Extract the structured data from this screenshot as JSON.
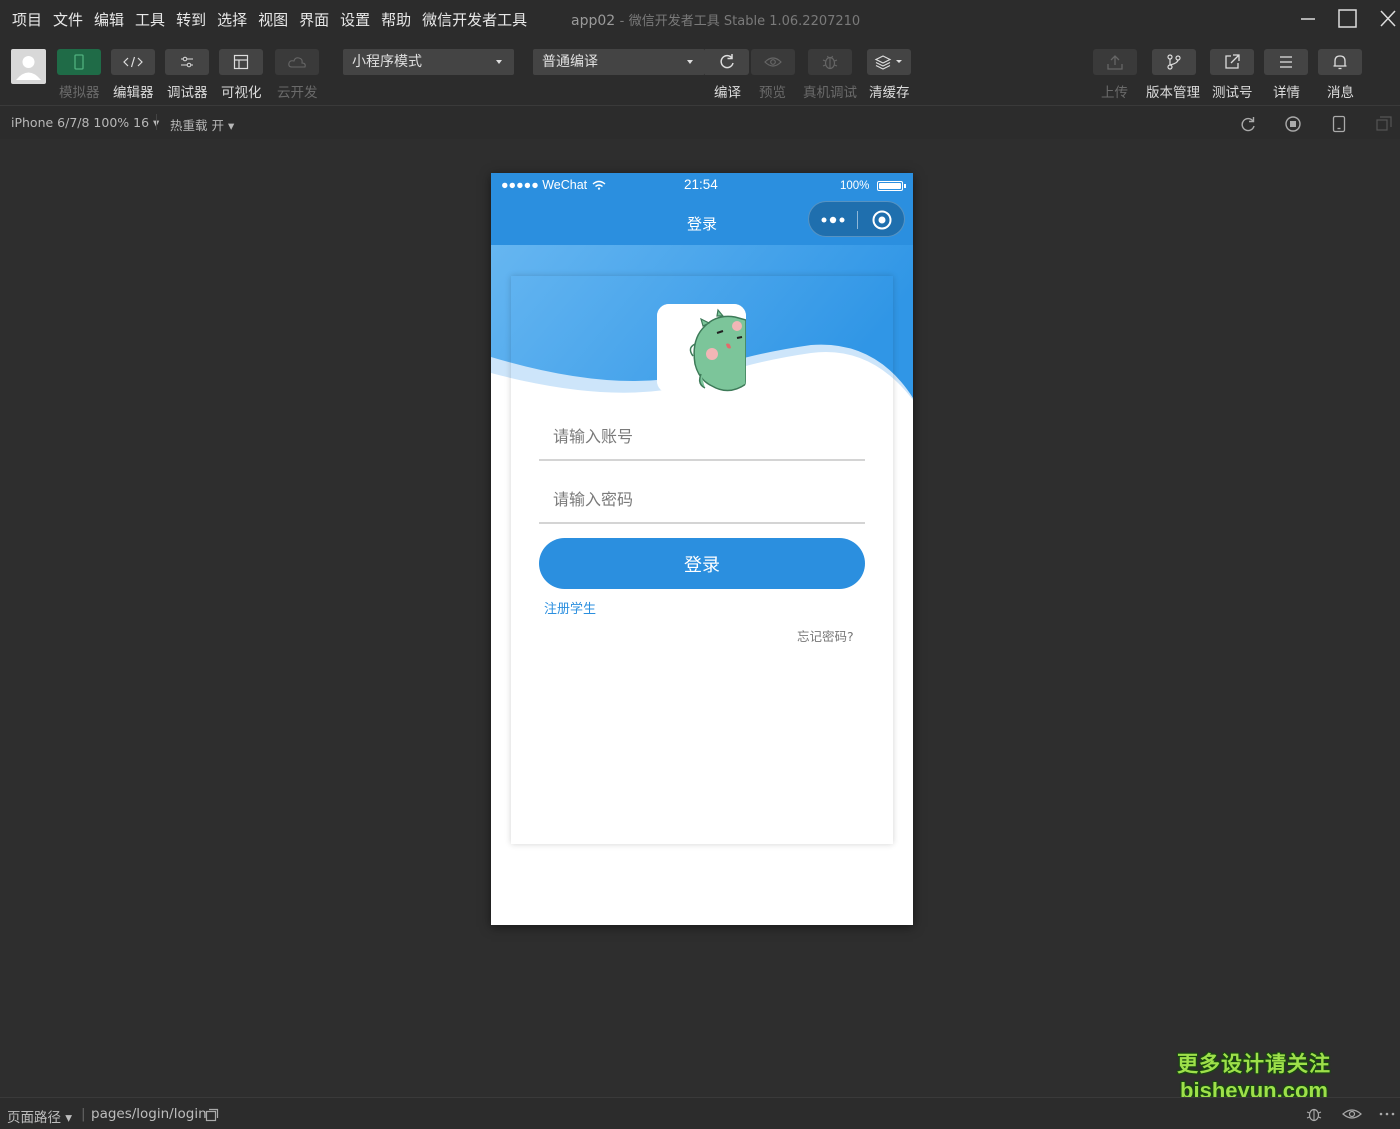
{
  "menu": [
    "项目",
    "文件",
    "编辑",
    "工具",
    "转到",
    "选择",
    "视图",
    "界面",
    "设置",
    "帮助",
    "微信开发者工具"
  ],
  "window": {
    "title": "app02",
    "separator": "-",
    "subtitle": "微信开发者工具 Stable 1.06.2207210"
  },
  "toolbar": {
    "simulator": "模拟器",
    "editor": "编辑器",
    "debugger": "调试器",
    "visual": "可视化",
    "cloud": "云开发",
    "mode_select": "小程序模式",
    "compile_select": "普通编译",
    "compile": "编译",
    "preview": "预览",
    "remote_debug": "真机调试",
    "clear_cache": "清缓存",
    "upload": "上传",
    "version": "版本管理",
    "test_id": "测试号",
    "details": "详情",
    "messages": "消息"
  },
  "subbar": {
    "device": "iPhone 6/7/8 100% 16 ▾",
    "hot_reload": "热重载 开 ▾"
  },
  "phone": {
    "carrier": "●●●●● WeChat",
    "time": "21:54",
    "battery_text": "100%",
    "battery_level": 1.0,
    "nav_title": "登录",
    "account_placeholder": "请输入账号",
    "password_placeholder": "请输入密码",
    "login_button": "登录",
    "register_link": "注册学生",
    "forgot_link": "忘记密码?"
  },
  "watermark": {
    "line1": "更多设计请关注",
    "line2": "bisheyun.com"
  },
  "statusbar": {
    "page_path_label": "页面路径 ▾",
    "divider": "|",
    "path": "pages/login/login"
  },
  "colors": {
    "primary": "#2b8fdf",
    "background": "#2c2c2c",
    "simulator_active": "#1f6b47"
  }
}
